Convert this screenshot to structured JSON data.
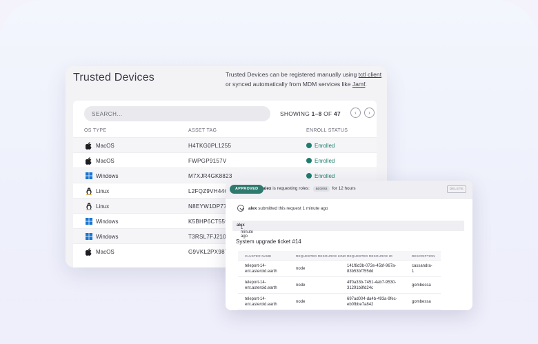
{
  "devices_panel": {
    "title": "Trusted Devices",
    "note_part1": "Trusted Devices can be registered manually using ",
    "note_link1": "tctl client",
    "note_part2": " or synced automatically from MDM services like ",
    "note_link2": "Jamf",
    "note_part3": ".",
    "search_placeholder": "SEARCH...",
    "showing_prefix": "SHOWING ",
    "showing_range": "1–8",
    "showing_of": " OF ",
    "showing_total": "47",
    "prev_icon": "‹",
    "next_icon": "›",
    "columns": [
      "OS TYPE",
      "ASSET TAG",
      "ENROLL STATUS"
    ],
    "status_color": "#1e7d6d",
    "rows": [
      {
        "os": "MacOS",
        "icon": "apple-icon",
        "asset": "H4TKG0PL1255",
        "status": "Enrolled"
      },
      {
        "os": "MacOS",
        "icon": "apple-icon",
        "asset": "FWPGP9157V",
        "status": "Enrolled"
      },
      {
        "os": "Windows",
        "icon": "windows-icon",
        "asset": "M7XJR4GK8823",
        "status": "Enrolled"
      },
      {
        "os": "Linux",
        "icon": "linux-icon",
        "asset": "L2FQZ9VH4463",
        "status": ""
      },
      {
        "os": "Linux",
        "icon": "linux-icon",
        "asset": "N8EYW1DP77",
        "status": ""
      },
      {
        "os": "Windows",
        "icon": "windows-icon",
        "asset": "K5BHP6CT559",
        "status": ""
      },
      {
        "os": "Windows",
        "icon": "windows-icon",
        "asset": "T3RSL7FJ2104",
        "status": ""
      },
      {
        "os": "MacOS",
        "icon": "apple-icon",
        "asset": "G9VKL2PX987",
        "status": ""
      }
    ]
  },
  "request_panel": {
    "badge": "APPROVED",
    "requester": "alex",
    "requesting_text": " is requesting roles: ",
    "role": "access",
    "duration": "for 12 hours",
    "delete_label": "DELETE",
    "submitted_user": "alex",
    "submitted_text": " submitted this request 1 minute ago",
    "comment_user": "alex",
    "comment_time": " 1 minute ago",
    "ticket": "System upgrade ticket #14",
    "table_headers": [
      "CLUSTER NAME",
      "REQUESTED RESOURCE KIND",
      "REQUESTED RESOURCE ID",
      "DESCRIPTION"
    ],
    "table_rows": [
      {
        "cluster": "teleport-14-\nent.asteroid.earth",
        "kind": "node",
        "id": "141f8d3b-072e-45bf-967a-\n83b53bf755dd",
        "desc": "cassandra-\n1"
      },
      {
        "cluster": "teleport-14-\nent.asteroid.earth",
        "kind": "node",
        "id": "4ff0a33b-7451-4ab7-9530-\n31291b8fd24c",
        "desc": "gombessa"
      },
      {
        "cluster": "teleport-14-\nent.asteroid.earth",
        "kind": "node",
        "id": "697ad004-da4b-493a-9fec-\neb0fbbe7a842",
        "desc": "gombessa"
      }
    ]
  }
}
